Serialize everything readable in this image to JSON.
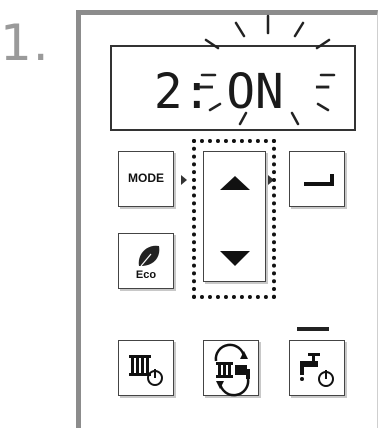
{
  "step": {
    "number": "1."
  },
  "display": {
    "parameter": "2:",
    "value": "ON",
    "blinking": true
  },
  "buttons": {
    "mode_label": "MODE",
    "eco_label": "Eco",
    "up_icon": "triangle-up-icon",
    "down_icon": "triangle-down-icon",
    "enter_icon": "enter-return-icon",
    "leaf_icon": "leaf-icon",
    "radiator_power_icon": "radiator-power-icon",
    "radiator_swap_icon": "radiator-sync-icon",
    "faucet_power_icon": "faucet-power-icon"
  },
  "highlight": {
    "target": "up-down-arrows",
    "style": "dotted"
  }
}
